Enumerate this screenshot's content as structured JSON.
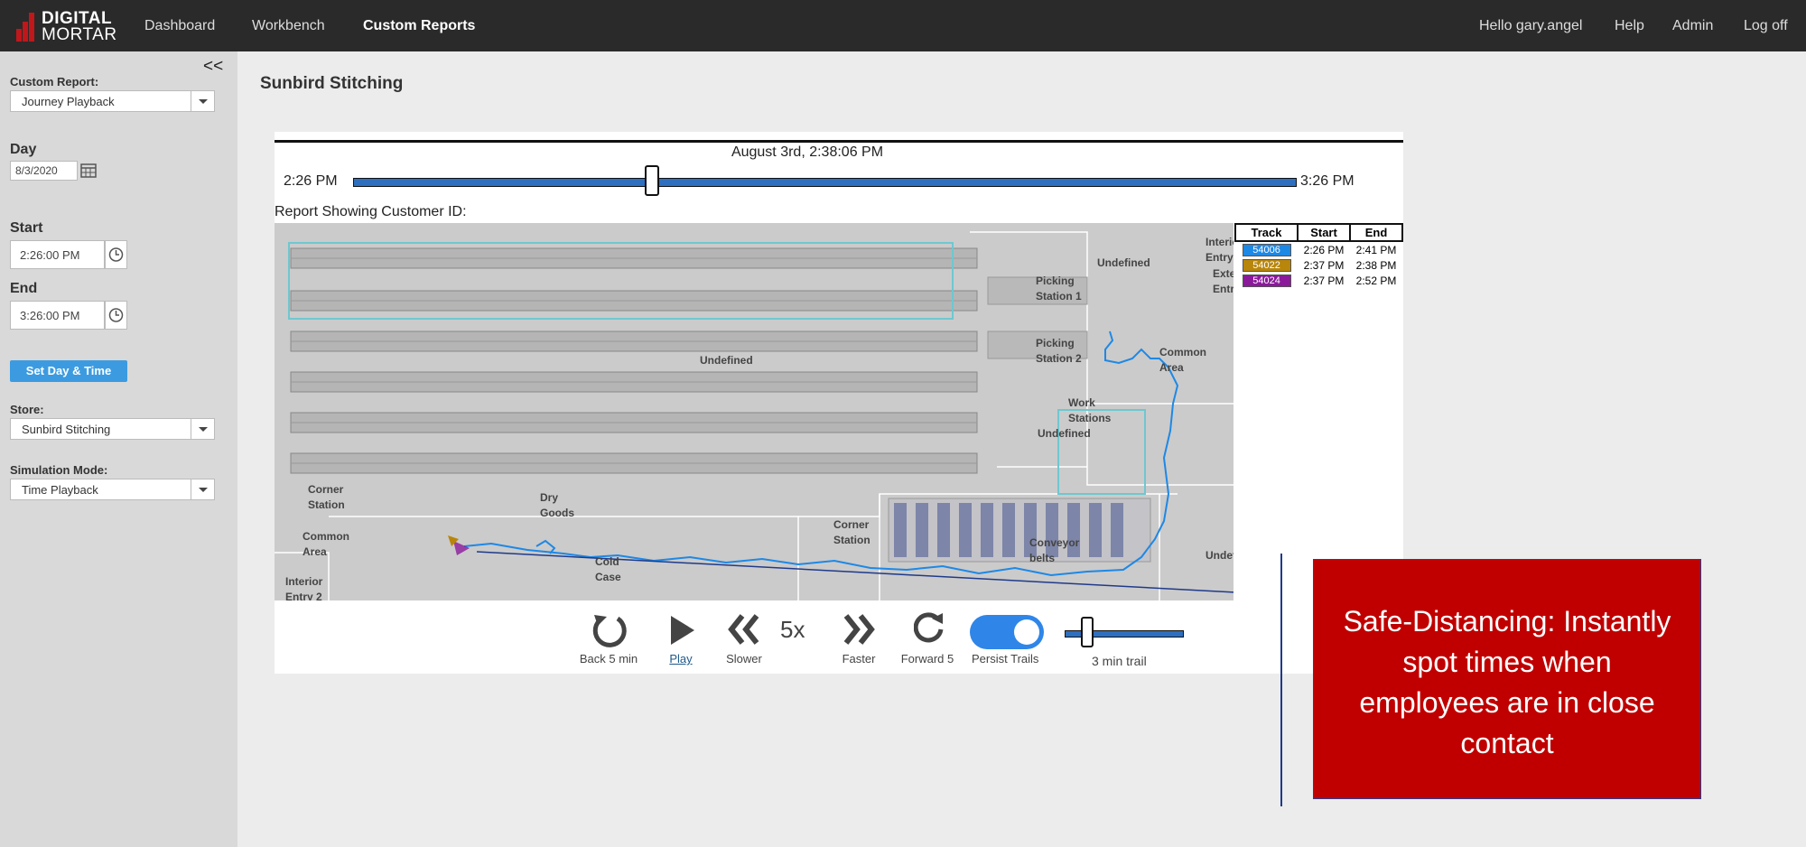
{
  "brand": {
    "line1": "DIGITAL",
    "line2": "MORTAR",
    "color": "#c0171b"
  },
  "nav": {
    "dashboard": "Dashboard",
    "workbench": "Workbench",
    "custom_reports": "Custom Reports"
  },
  "user": {
    "greeting": "Hello gary.angel",
    "help": "Help",
    "admin": "Admin",
    "logoff": "Log off"
  },
  "sidebar": {
    "collapse": "<<",
    "custom_report_label": "Custom Report:",
    "custom_report_value": "Journey Playback",
    "day_label": "Day",
    "day_value": "8/3/2020",
    "start_label": "Start",
    "start_value": "2:26:00 PM",
    "end_label": "End",
    "end_value": "3:26:00 PM",
    "set_button": "Set Day & Time",
    "store_label": "Store:",
    "store_value": "Sunbird Stitching",
    "sim_label": "Simulation Mode:",
    "sim_value": "Time Playback"
  },
  "page_title": "Sunbird Stitching",
  "timeline": {
    "current": "August 3rd, 2:38:06 PM",
    "start": "2:26 PM",
    "end": "3:26 PM",
    "position_fraction": 0.2
  },
  "report_label": "Report Showing Customer ID:",
  "map_labels": {
    "undefined_top": "Undefined",
    "picking1": "Picking Station 1",
    "picking2": "Picking Station 2",
    "common_area_right": "Common Area",
    "work_stations": "Work Stations",
    "undefined_mid": "Undefined",
    "undefined_center": "Undefined",
    "corner_station_left": "Corner Station",
    "dry_goods": "Dry Goods",
    "common_area_left": "Common Area",
    "cold_case": "Cold Case",
    "interior_entry2": "Interior Entry 2",
    "corner_station_mid": "Corner Station",
    "conveyor_belts": "Conveyor belts",
    "undefined_right": "Undefined",
    "interior_entry": "Interior Entry",
    "exterior_entry": "Exterior Entry"
  },
  "legend": {
    "headers": [
      "Track",
      "Start",
      "End"
    ],
    "rows": [
      {
        "track": "54006",
        "start": "2:26 PM",
        "end": "2:41 PM",
        "color": "#1e88e5"
      },
      {
        "track": "54022",
        "start": "2:37 PM",
        "end": "2:38 PM",
        "color": "#b8860b"
      },
      {
        "track": "54024",
        "start": "2:37 PM",
        "end": "2:52 PM",
        "color": "#8b1a9b"
      }
    ]
  },
  "controls": {
    "back": "Back 5 min",
    "play": "Play",
    "slower": "Slower",
    "speed": "5x",
    "faster": "Faster",
    "forward": "Forward 5",
    "persist": "Persist Trails",
    "trail": "3 min trail"
  },
  "callout": "Safe-Distancing: Instantly spot times when employees are in close contact"
}
